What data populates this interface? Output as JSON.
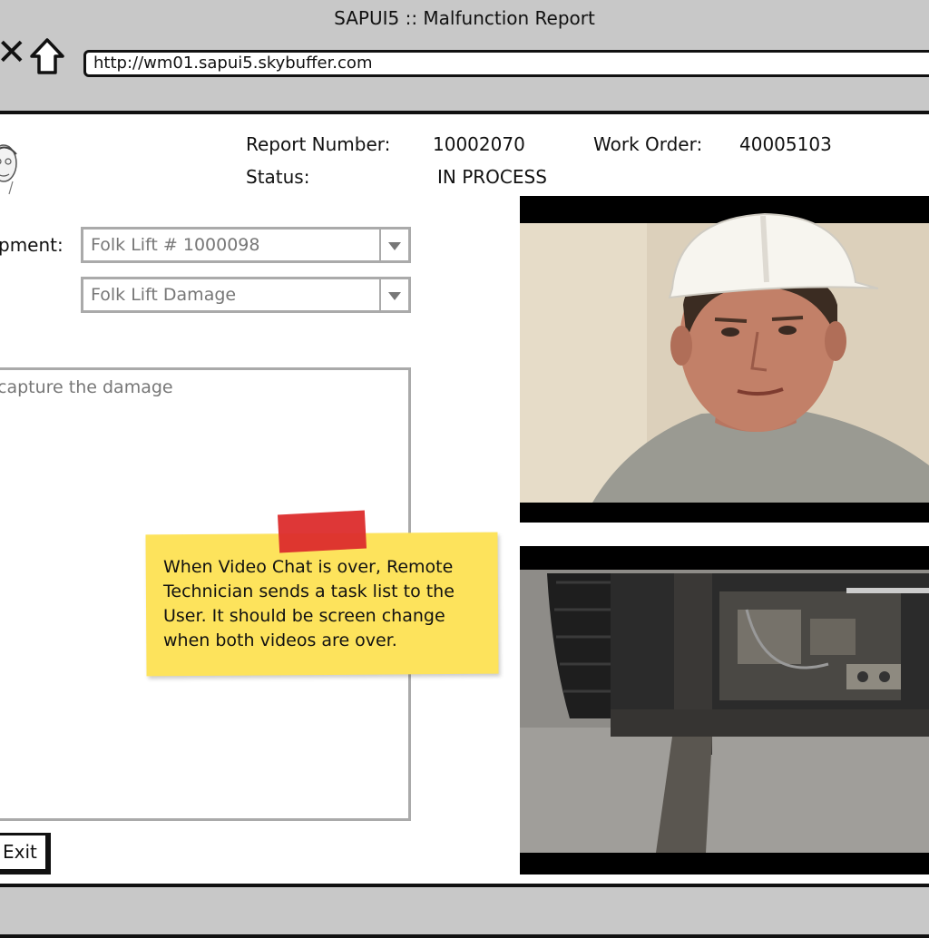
{
  "window": {
    "title": "SAPUI5 :: Malfunction Report"
  },
  "browser": {
    "url": "http://wm01.sapui5.skybuffer.com"
  },
  "header": {
    "report_number_label": "Report Number:",
    "report_number": "10002070",
    "work_order_label": "Work Order:",
    "work_order": "40005103",
    "status_label": "Status:",
    "status": "IN PROCESS"
  },
  "form": {
    "equipment_label": "pment:",
    "equipment_value": "Folk Lift # 1000098",
    "damage_value": "Folk Lift Damage",
    "description_placeholder": "capture the damage",
    "exit_label": "Exit"
  },
  "note": {
    "text": "When Video Chat is over, Remote Technician sends a task list to the User. It should be screen change when both videos are over."
  },
  "icons": {
    "close": "close-icon",
    "home": "home-icon",
    "dropdown": "chevron-down-icon"
  },
  "colors": {
    "chrome": "#c8c8c8",
    "note": "#fde35c",
    "tape": "#dc2c2c"
  }
}
